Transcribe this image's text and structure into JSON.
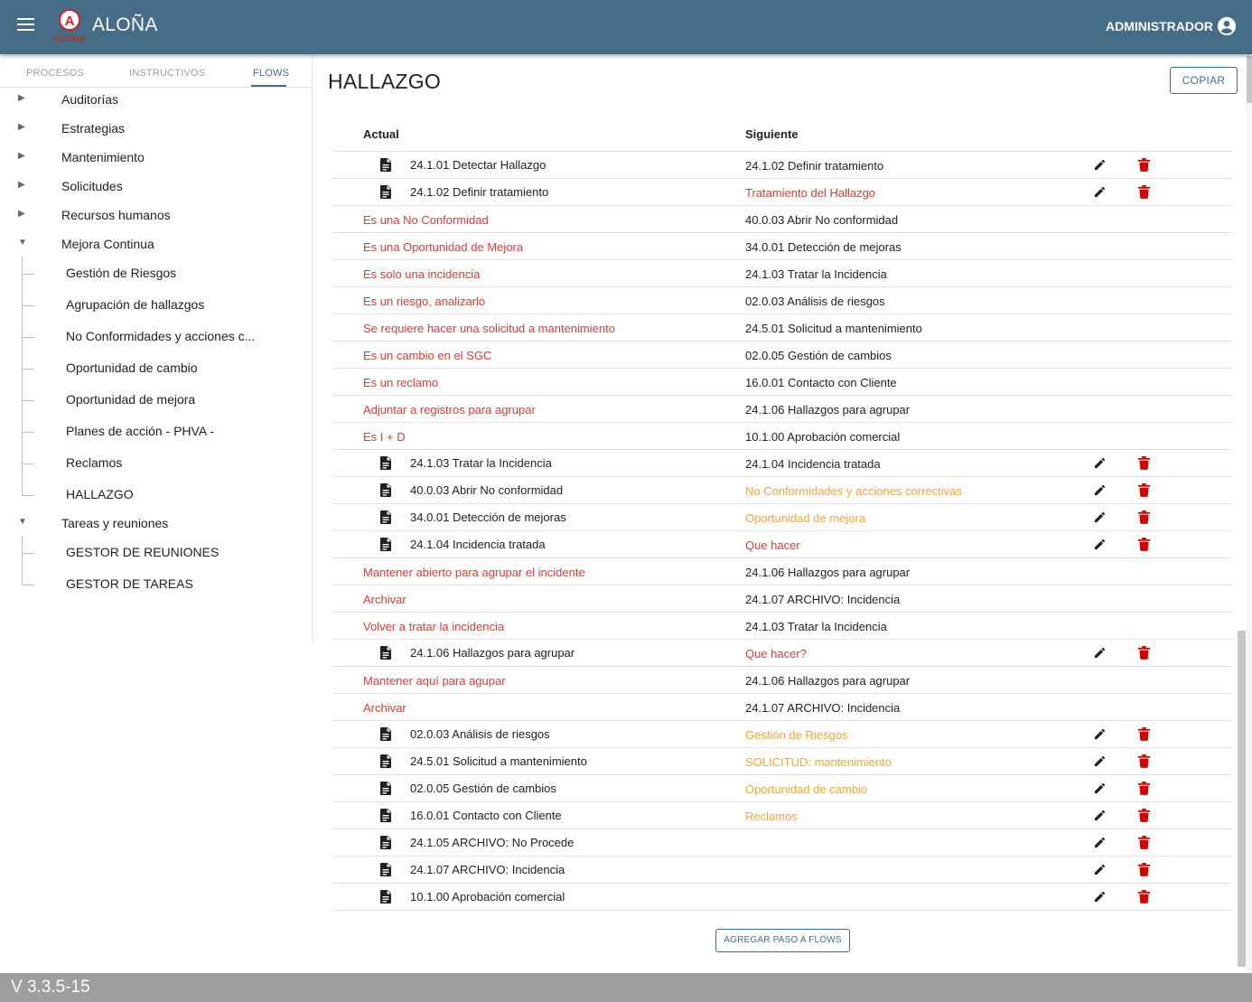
{
  "app": {
    "name": "ALOÑA",
    "logo_text": "ALOÑA",
    "user": "ADMINISTRADOR",
    "version": "V 3.3.5-15"
  },
  "sidebar": {
    "tabs": [
      "PROCESOS",
      "INSTRUCTIVOS",
      "FLOWS"
    ],
    "active_tab": "FLOWS",
    "tree": [
      {
        "label": "Auditorías",
        "expanded": false
      },
      {
        "label": "Estrategias",
        "expanded": false
      },
      {
        "label": "Mantenimiento",
        "expanded": false
      },
      {
        "label": "Solicitudes",
        "expanded": false
      },
      {
        "label": "Recursos humanos",
        "expanded": false
      },
      {
        "label": "Mejora Continua",
        "expanded": true,
        "children": [
          "Gestión de Riesgos",
          "Agrupación de hallazgos",
          "No Conformidades y acciones c...",
          "Oportunidad de cambio",
          "Oportunidad de mejora",
          "Planes de acción - PHVA -",
          "Reclamos",
          "HALLAZGO"
        ]
      },
      {
        "label": "Tareas y reuniones",
        "expanded": true,
        "children": [
          "GESTOR DE REUNIONES",
          "GESTOR DE TAREAS"
        ]
      }
    ]
  },
  "main": {
    "title": "HALLAZGO",
    "copy_label": "COPIAR",
    "columns": {
      "actual": "Actual",
      "next": "Siguiente"
    },
    "add_label": "AGREGAR PASO A FLOWS",
    "rows": [
      {
        "kind": "step",
        "actual": "24.1.01 Detectar Hallazgo",
        "next": "24.1.02 Definir tratamiento",
        "next_color": "dark"
      },
      {
        "kind": "step",
        "actual": "24.1.02 Definir tratamiento",
        "next": "Tratamiento del Hallazgo",
        "next_color": "red"
      },
      {
        "kind": "option",
        "actual": "Es una No Conformidad",
        "next": "40.0.03 Abrir No conformidad",
        "next_color": "dark"
      },
      {
        "kind": "option",
        "actual": "Es una Oportunidad de Mejora",
        "next": "34.0.01 Detección de mejoras",
        "next_color": "dark"
      },
      {
        "kind": "option",
        "actual": "Es solo una incidencia",
        "next": "24.1.03 Tratar la Incidencia",
        "next_color": "dark"
      },
      {
        "kind": "option",
        "actual": "Es un riesgo, analizarlo",
        "next": "02.0.03 Análisis de riesgos",
        "next_color": "dark"
      },
      {
        "kind": "option",
        "actual": "Se requiere hacer una solicitud a mantenimiento",
        "next": "24.5.01 Solicitud a mantenimiento",
        "next_color": "dark"
      },
      {
        "kind": "option",
        "actual": "Es un cambio en el SGC",
        "next": "02.0.05 Gestión de cambios",
        "next_color": "dark"
      },
      {
        "kind": "option",
        "actual": "Es un reclamo",
        "next": "16.0.01 Contacto con Cliente",
        "next_color": "dark"
      },
      {
        "kind": "option",
        "actual": "Adjuntar a registros para agrupar",
        "next": "24.1.06 Hallazgos para agrupar",
        "next_color": "dark"
      },
      {
        "kind": "option",
        "actual": "Es I + D",
        "next": "10.1.00 Aprobación comercial",
        "next_color": "dark"
      },
      {
        "kind": "step",
        "actual": "24.1.03 Tratar la Incidencia",
        "next": "24.1.04 Incidencia tratada",
        "next_color": "dark"
      },
      {
        "kind": "step",
        "actual": "40.0.03 Abrir No conformidad",
        "next": "No Conformidades y acciones correctivas",
        "next_color": "amber"
      },
      {
        "kind": "step",
        "actual": "34.0.01 Detección de mejoras",
        "next": "Oportunidad de mejora",
        "next_color": "amber"
      },
      {
        "kind": "step",
        "actual": "24.1.04 Incidencia tratada",
        "next": "Que hacer",
        "next_color": "red"
      },
      {
        "kind": "option",
        "actual": "Mantener abierto para agrupar el incidente",
        "next": "24.1.06 Hallazgos para agrupar",
        "next_color": "dark"
      },
      {
        "kind": "option",
        "actual": "Archivar",
        "next": "24.1.07 ARCHIVO: Incidencia",
        "next_color": "dark"
      },
      {
        "kind": "option",
        "actual": "Volver a tratar la incidencia",
        "next": "24.1.03 Tratar la Incidencia",
        "next_color": "dark"
      },
      {
        "kind": "step",
        "actual": "24.1.06 Hallazgos para agrupar",
        "next": "Que hacer?",
        "next_color": "red"
      },
      {
        "kind": "option",
        "actual": "Mantener aquí para agupar",
        "next": "24.1.06 Hallazgos para agrupar",
        "next_color": "dark"
      },
      {
        "kind": "option",
        "actual": "Archivar",
        "next": "24.1.07 ARCHIVO: Incidencia",
        "next_color": "dark"
      },
      {
        "kind": "step",
        "actual": "02.0.03 Análisis de riesgos",
        "next": "Gestión de Riesgos",
        "next_color": "amber"
      },
      {
        "kind": "step",
        "actual": "24.5.01 Solicitud a mantenimiento",
        "next": "SOLICITUD: mantenimiento",
        "next_color": "amber"
      },
      {
        "kind": "step",
        "actual": "02.0.05 Gestión de cambios",
        "next": "Oportunidad de cambio",
        "next_color": "amber"
      },
      {
        "kind": "step",
        "actual": "16.0.01 Contacto con Cliente",
        "next": "Reclamos",
        "next_color": "amber"
      },
      {
        "kind": "step",
        "actual": "24.1.05 ARCHIVO: No Procede",
        "next": "",
        "next_color": "dark"
      },
      {
        "kind": "step",
        "actual": "24.1.07 ARCHIVO: Incidencia",
        "next": "",
        "next_color": "dark"
      },
      {
        "kind": "step",
        "actual": "10.1.00 Aprobación comercial",
        "next": "",
        "next_color": "dark"
      }
    ]
  },
  "colors": {
    "primary": "#456d88",
    "red": "#e53935",
    "amber": "#f9a825",
    "delete": "#d50000"
  },
  "icons": {
    "menu": "menu-icon",
    "user": "account-circle-icon",
    "doc": "document-icon",
    "edit": "pencil-icon",
    "delete": "trash-icon"
  }
}
